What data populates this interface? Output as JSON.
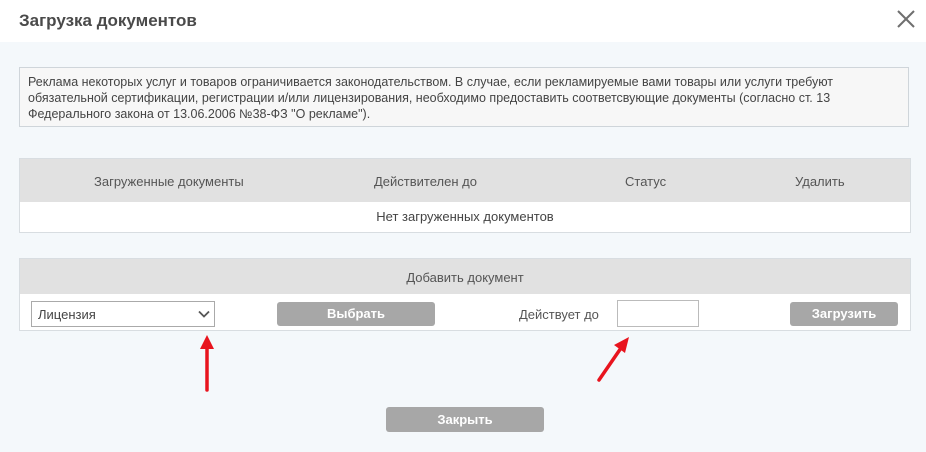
{
  "dialog": {
    "title": "Загрузка документов",
    "notice": "Реклама некоторых услуг и товаров ограничивается законодательством. В случае, если рекламируемые вами товары или услуги требуют обязательной сертификации, регистрации и/или лицензирования, необходимо предоставить соответсвующие документы (согласно ст. 13 Федерального закона от 13.06.2006 №38-ФЗ \"О рекламе\")."
  },
  "documents_table": {
    "columns": [
      "Загруженные документы",
      "Действителен до",
      "Статус",
      "Удалить"
    ],
    "empty_message": "Нет загруженных документов"
  },
  "add_document": {
    "title": "Добавить документ",
    "doc_type_selected": "Лицензия",
    "choose_label": "Выбрать",
    "valid_until_label": "Действует до",
    "valid_until_value": "",
    "upload_label": "Загрузить"
  },
  "footer": {
    "close_label": "Закрыть"
  },
  "icons": {
    "close": "close-icon",
    "dropdown": "chevron-down-icon",
    "annotation": "red-arrow-icon"
  },
  "colors": {
    "button_bg": "#a7a7a7",
    "header_bg": "#e1e1e1",
    "annotation_arrow": "#e8141e"
  }
}
